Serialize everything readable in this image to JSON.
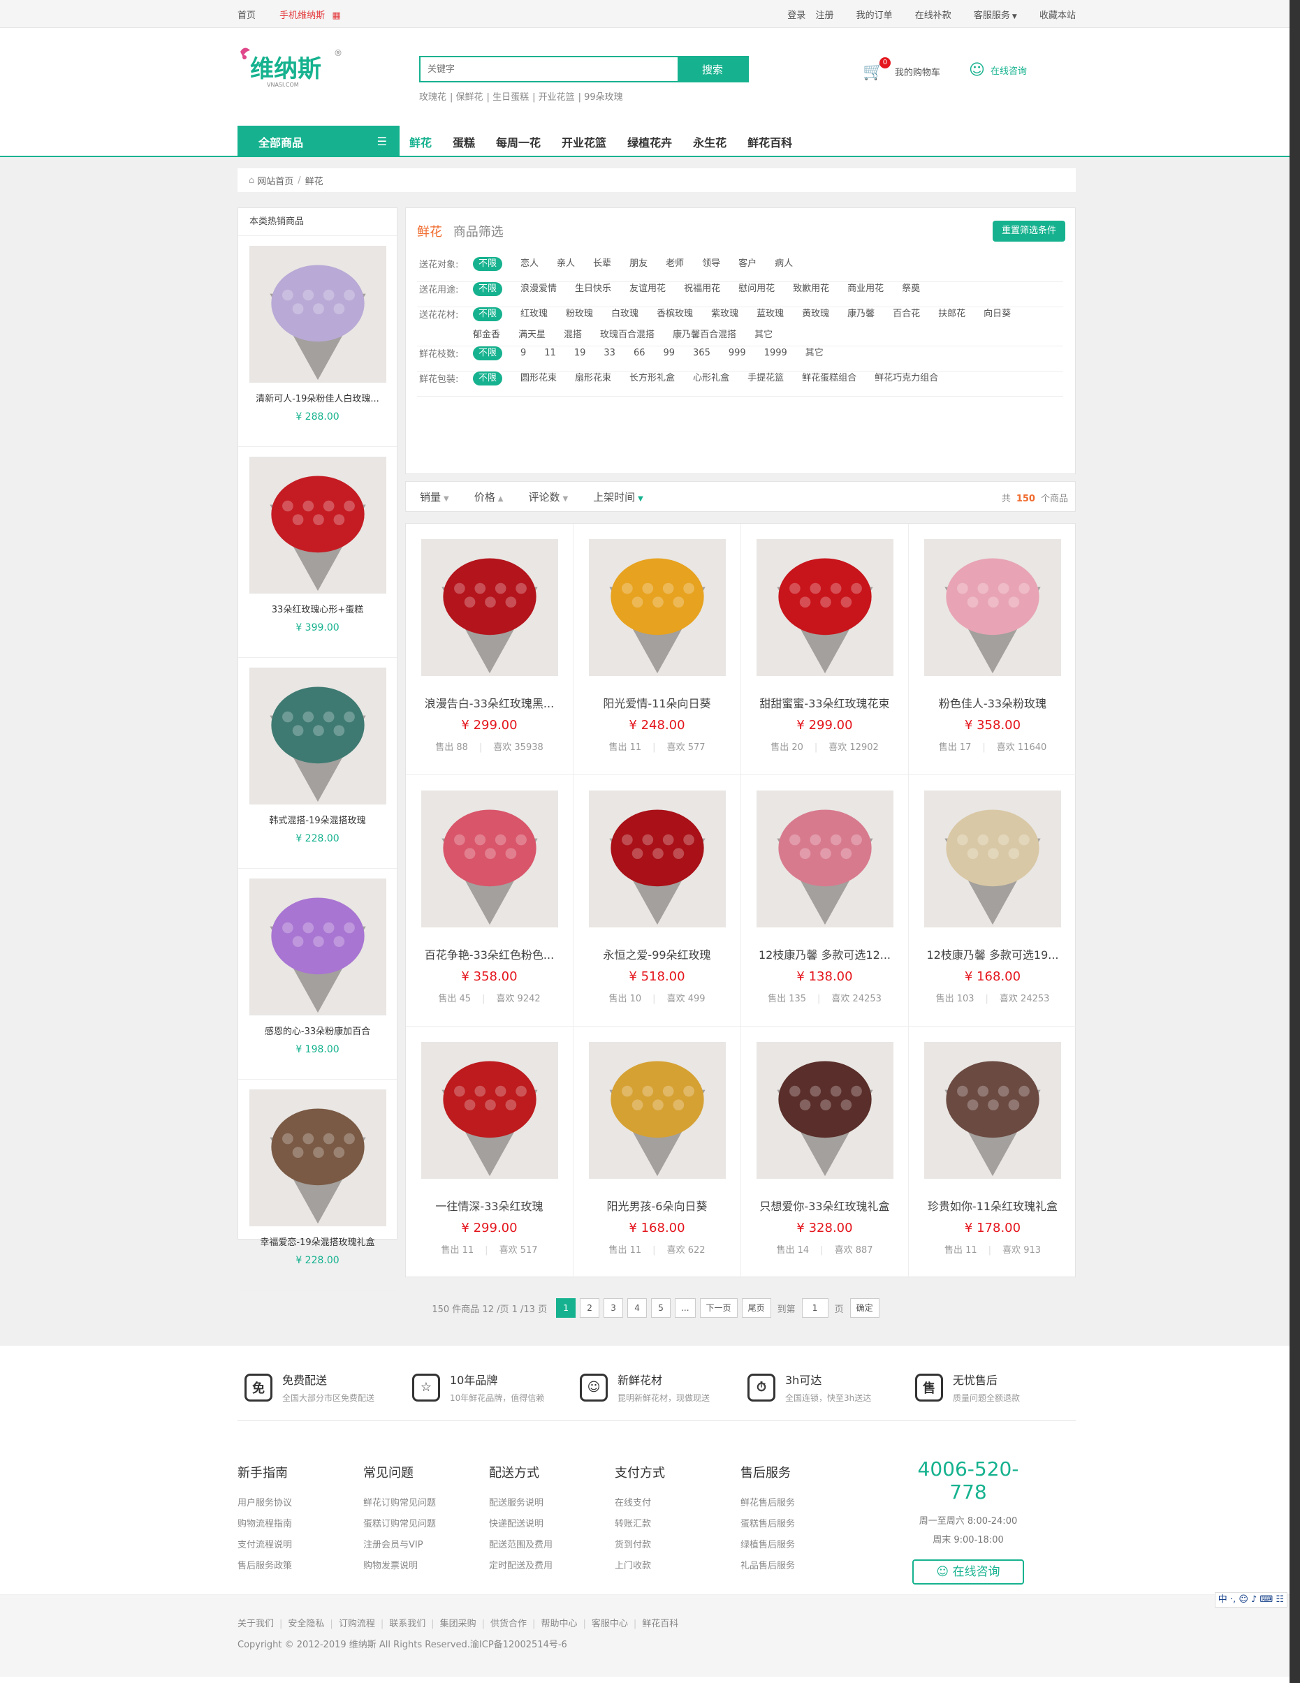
{
  "topbar": {
    "home": "首页",
    "mobile": "手机维纳斯",
    "login": "登录",
    "register": "注册",
    "orders": "我的订单",
    "pay": "在线补款",
    "service": "客服服务",
    "favorite": "收藏本站"
  },
  "logo": {
    "text": "维纳斯",
    "sub": "VNASI.COM"
  },
  "search": {
    "placeholder": "关键字",
    "button": "搜索",
    "hotwords": [
      "玫瑰花",
      "保鲜花",
      "生日蛋糕",
      "开业花篮",
      "99朵玫瑰"
    ]
  },
  "cart": {
    "label": "我的购物车",
    "count": "0"
  },
  "consult_label": "在线咨询",
  "nav": {
    "all": "全部商品",
    "items": [
      "鲜花",
      "蛋糕",
      "每周一花",
      "开业花篮",
      "绿植花卉",
      "永生花",
      "鲜花百科"
    ]
  },
  "breadcrumb": {
    "home": "网站首页",
    "current": "鲜花"
  },
  "side": {
    "title": "本类热销商品",
    "items": [
      {
        "name": "清新可人-19朵粉佳人白玫瑰...",
        "price": "¥ 288.00",
        "color": "#b9a9d6"
      },
      {
        "name": "33朵红玫瑰心形+蛋糕",
        "price": "¥ 399.00",
        "color": "#c51c24"
      },
      {
        "name": "韩式混搭-19朵混搭玫瑰",
        "price": "¥ 228.00",
        "color": "#3e7a72"
      },
      {
        "name": "感恩的心-33朵粉康加百合",
        "price": "¥ 198.00",
        "color": "#a875d2"
      },
      {
        "name": "幸福爱恋-19朵混搭玫瑰礼盒",
        "price": "¥ 228.00",
        "color": "#7a5a45"
      }
    ]
  },
  "filter": {
    "title": "鲜花",
    "subtitle": "商品筛选",
    "reset": "重置筛选条件",
    "rows": [
      {
        "label": "送花对象:",
        "options": [
          "不限",
          "恋人",
          "亲人",
          "长辈",
          "朋友",
          "老师",
          "领导",
          "客户",
          "病人"
        ]
      },
      {
        "label": "送花用途:",
        "options": [
          "不限",
          "浪漫爱情",
          "生日快乐",
          "友谊用花",
          "祝福用花",
          "慰问用花",
          "致歉用花",
          "商业用花",
          "祭奠"
        ]
      },
      {
        "label": "送花花材:",
        "options": [
          "不限",
          "红玫瑰",
          "粉玫瑰",
          "白玫瑰",
          "香槟玫瑰",
          "紫玫瑰",
          "蓝玫瑰",
          "黄玫瑰",
          "康乃馨",
          "百合花",
          "扶郎花",
          "向日葵",
          "郁金香",
          "满天星",
          "混搭",
          "玫瑰百合混搭",
          "康乃馨百合混搭",
          "其它"
        ]
      },
      {
        "label": "鲜花枝数:",
        "options": [
          "不限",
          "9",
          "11",
          "19",
          "33",
          "66",
          "99",
          "365",
          "999",
          "1999",
          "其它"
        ]
      },
      {
        "label": "鲜花包装:",
        "options": [
          "不限",
          "圆形花束",
          "扇形花束",
          "长方形礼盒",
          "心形礼盒",
          "手提花篮",
          "鲜花蛋糕组合",
          "鲜花巧克力组合"
        ]
      }
    ]
  },
  "sort": {
    "items": [
      "销量",
      "价格",
      "评论数",
      "上架时间"
    ],
    "total_prefix": "共",
    "total": "150",
    "total_suffix": "个商品"
  },
  "products": [
    {
      "name": "浪漫告白-33朵红玫瑰黑...",
      "price": "¥ 299.00",
      "sold": "售出 88",
      "like": "喜欢 35938",
      "color": "#b4141c"
    },
    {
      "name": "阳光爱情-11朵向日葵",
      "price": "¥ 248.00",
      "sold": "售出 11",
      "like": "喜欢 577",
      "color": "#e7a21f"
    },
    {
      "name": "甜甜蜜蜜-33朵红玫瑰花束",
      "price": "¥ 299.00",
      "sold": "售出 20",
      "like": "喜欢 12902",
      "color": "#c8141b"
    },
    {
      "name": "粉色佳人-33朵粉玫瑰",
      "price": "¥ 358.00",
      "sold": "售出 17",
      "like": "喜欢 11640",
      "color": "#e8a4b4"
    },
    {
      "name": "百花争艳-33朵红色粉色...",
      "price": "¥ 358.00",
      "sold": "售出 45",
      "like": "喜欢 9242",
      "color": "#d9556a"
    },
    {
      "name": "永恒之爱-99朵红玫瑰",
      "price": "¥ 518.00",
      "sold": "售出 10",
      "like": "喜欢 499",
      "color": "#a91017"
    },
    {
      "name": "12枝康乃馨 多款可选12...",
      "price": "¥ 138.00",
      "sold": "售出 135",
      "like": "喜欢 24253",
      "color": "#d87a8e"
    },
    {
      "name": "12枝康乃馨 多款可选19...",
      "price": "¥ 168.00",
      "sold": "售出 103",
      "like": "喜欢 24253",
      "color": "#d9c8a5"
    },
    {
      "name": "一往情深-33朵红玫瑰",
      "price": "¥ 299.00",
      "sold": "售出 11",
      "like": "喜欢 517",
      "color": "#bd1b1e"
    },
    {
      "name": "阳光男孩-6朵向日葵",
      "price": "¥ 168.00",
      "sold": "售出 11",
      "like": "喜欢 622",
      "color": "#d6a133"
    },
    {
      "name": "只想爱你-33朵红玫瑰礼盒",
      "price": "¥ 328.00",
      "sold": "售出 14",
      "like": "喜欢 887",
      "color": "#5a2e2a"
    },
    {
      "name": "珍贵如你-11朵红玫瑰礼盒",
      "price": "¥ 178.00",
      "sold": "售出 11",
      "like": "喜欢 913",
      "color": "#6b4a42"
    }
  ],
  "pager": {
    "info": "150 件商品 12 /页 1 /13 页",
    "pages": [
      "1",
      "2",
      "3",
      "4",
      "5",
      "...",
      "下一页",
      "尾页"
    ],
    "goto": "到第",
    "page_value": "1",
    "page_unit": "页",
    "confirm": "确定"
  },
  "services": [
    {
      "icon": "免",
      "title": "免费配送",
      "desc": "全国大部分市区免费配送"
    },
    {
      "icon": "☆",
      "title": "10年品牌",
      "desc": "10年鲜花品牌，值得信赖"
    },
    {
      "icon": "☺",
      "title": "新鲜花材",
      "desc": "昆明新鲜花材，现做现送"
    },
    {
      "icon": "⏱",
      "title": "3h可达",
      "desc": "全国连锁，快至3h送达"
    },
    {
      "icon": "售",
      "title": "无忧售后",
      "desc": "质量问题全额退款"
    }
  ],
  "footer_cols": [
    {
      "title": "新手指南",
      "links": [
        "用户服务协议",
        "购物流程指南",
        "支付流程说明",
        "售后服务政策"
      ]
    },
    {
      "title": "常见问题",
      "links": [
        "鲜花订购常见问题",
        "蛋糕订购常见问题",
        "注册会员与VIP",
        "购物发票说明"
      ]
    },
    {
      "title": "配送方式",
      "links": [
        "配送服务说明",
        "快递配送说明",
        "配送范围及费用",
        "定时配送及费用"
      ]
    },
    {
      "title": "支付方式",
      "links": [
        "在线支付",
        "转账汇款",
        "货到付款",
        "上门收款"
      ]
    },
    {
      "title": "售后服务",
      "links": [
        "鲜花售后服务",
        "蛋糕售后服务",
        "绿植售后服务",
        "礼品售后服务"
      ]
    }
  ],
  "hotline": {
    "number": "4006-520-778",
    "weekday": "周一至周六 8:00-24:00",
    "weekend": "周末 9:00-18:00",
    "button": "在线咨询"
  },
  "bottom": {
    "links": [
      "关于我们",
      "安全隐私",
      "订购流程",
      "联系我们",
      "集团采购",
      "供货合作",
      "帮助中心",
      "客服中心",
      "鲜花百科"
    ],
    "copyright": "Copyright © 2012-2019 维纳斯 All Rights Reserved.渝ICP备12002514号-6"
  },
  "ime": "中 ·, ☺ ♪ ⌨ ☷"
}
